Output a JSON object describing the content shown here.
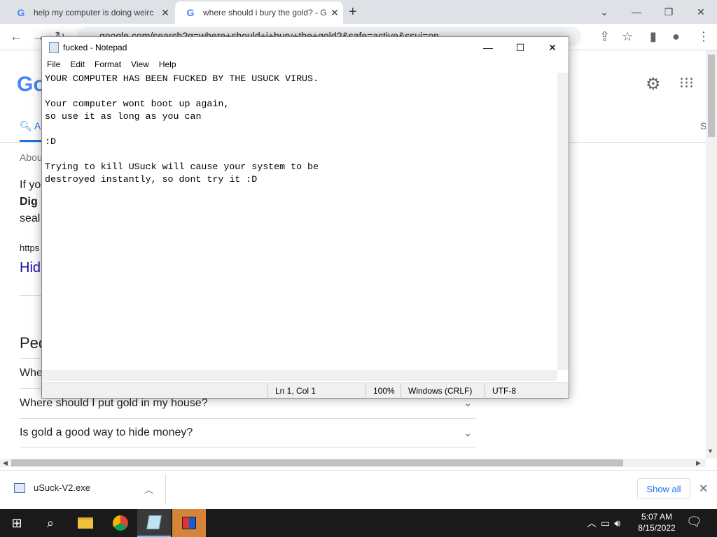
{
  "browser": {
    "tabs": [
      {
        "title": "help my computer is doing weirc",
        "active": false
      },
      {
        "title": "where should i bury the gold? - G",
        "active": true
      }
    ],
    "new_tab": "+",
    "url": "google.com/search?q=where+should+i+bury+the+gold?&safe=active&ssui=on"
  },
  "google": {
    "logo": "Go",
    "tab_all": "A",
    "about": "Abou",
    "snippet_lines": [
      "If yo",
      "Dig a",
      "seal"
    ],
    "url_line": "https",
    "result_title": "Hid",
    "people_also_ask": "Peo",
    "side_letter": "S",
    "questions": [
      "Whe",
      "Where should I put gold in my house?",
      "Is gold a good way to hide money?"
    ]
  },
  "notepad": {
    "title": "fucked - Notepad",
    "menu": [
      "File",
      "Edit",
      "Format",
      "View",
      "Help"
    ],
    "content": "YOUR COMPUTER HAS BEEN FUCKED BY THE USUCK VIRUS.\n\nYour computer wont boot up again,\nso use it as long as you can\n\n:D\n\nTrying to kill USuck will cause your system to be\ndestroyed instantly, so dont try it :D",
    "status": {
      "position": "Ln 1, Col 1",
      "zoom": "100%",
      "line_endings": "Windows (CRLF)",
      "encoding": "UTF-8"
    }
  },
  "downloads": {
    "file": "uSuck-V2.exe",
    "show_all": "Show all"
  },
  "taskbar": {
    "time": "5:07 AM",
    "date": "8/15/2022"
  },
  "colors": {
    "link": "#1a0dab",
    "accent": "#1a73e8",
    "taskbar": "#1a1a1a"
  }
}
